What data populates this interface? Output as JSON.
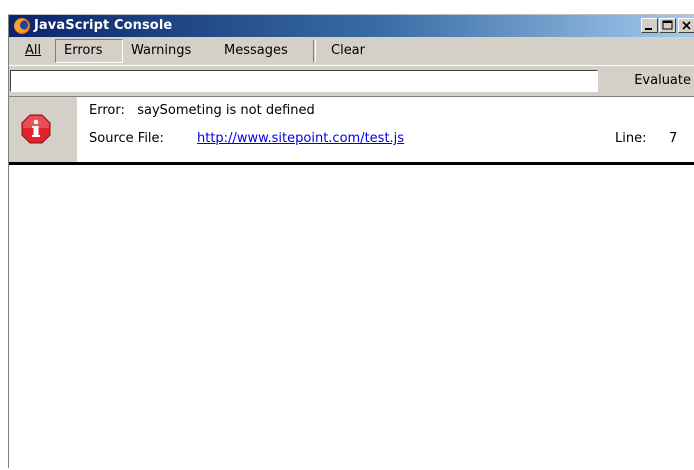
{
  "window": {
    "title": "JavaScript Console",
    "controls": {
      "minimize": "minimize",
      "maximize": "maximize",
      "close": "close"
    }
  },
  "toolbar": {
    "tabs": [
      {
        "label": "All",
        "selected": false
      },
      {
        "label": "Errors",
        "selected": true
      },
      {
        "label": "Warnings",
        "selected": false
      },
      {
        "label": "Messages",
        "selected": false
      }
    ],
    "clear_label": "Clear"
  },
  "evaluate": {
    "input_value": "",
    "button_label": "Evaluate"
  },
  "messages": [
    {
      "type": "error",
      "icon": "error-info-icon",
      "prefix": "Error:",
      "text": "saySometing is not defined",
      "source_label": "Source File:",
      "source_url": "http://www.sitepoint.com/test.js",
      "line_label": "Line:",
      "line": "7"
    }
  ],
  "colors": {
    "title_gradient_start": "#0a246a",
    "title_gradient_end": "#a6caf0",
    "chrome": "#d4d0c8",
    "link": "#0000ee",
    "error_icon": "#e0232c"
  }
}
